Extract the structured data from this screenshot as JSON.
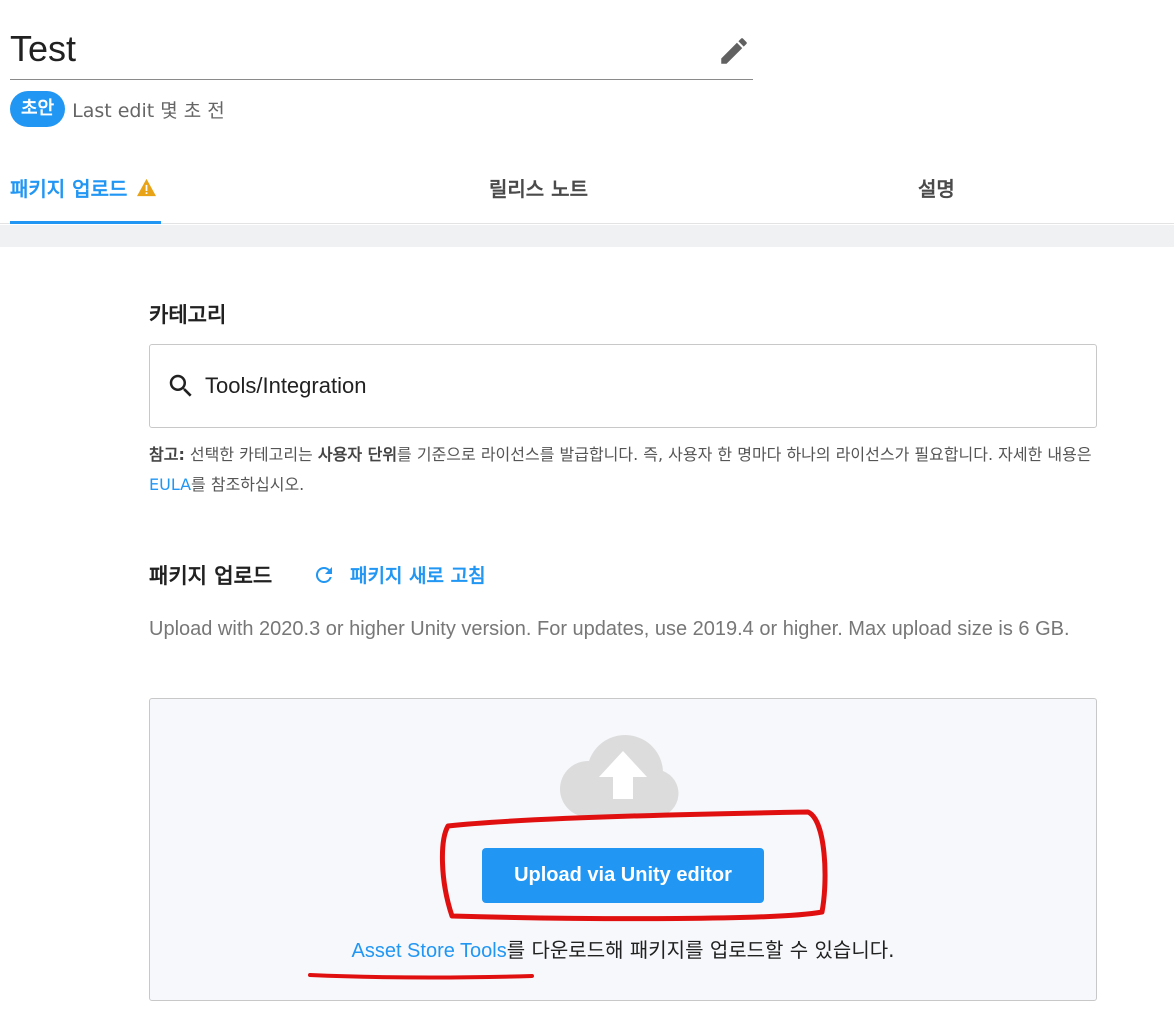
{
  "page": {
    "title": "Test",
    "status_badge": "초안",
    "last_edit": "Last edit 몇 초 전"
  },
  "tabs": [
    {
      "label": "패키지 업로드",
      "active": true,
      "icon": "warning-icon"
    },
    {
      "label": "릴리스 노트",
      "active": false
    },
    {
      "label": "설명",
      "active": false
    }
  ],
  "category": {
    "title": "카테고리",
    "value": "Tools/Integration",
    "icon": "search-icon",
    "note_prefix": "참고:",
    "note_part1": " 선택한 카테고리는 ",
    "note_bold": "사용자 단위",
    "note_part2": "를 기준으로 라이선스를 발급합니다. 즉, 사용자 한 명마다 하나의 라이선스가 필요합니다. 자세한 내용은 ",
    "note_link": "EULA",
    "note_part3": "를 참조하십시오."
  },
  "upload": {
    "title": "패키지 업로드",
    "refresh_label": "패키지 새로 고침",
    "description": "Upload with 2020.3 or higher Unity version. For updates, use 2019.4 or higher. Max upload size is 6 GB.",
    "button_label": "Upload via Unity editor",
    "tools_link": "Asset Store Tools",
    "tools_text": "를 다운로드해 패키지를 업로드할 수 있습니다."
  },
  "colors": {
    "accent": "#2196f3",
    "warning": "#e8a317",
    "annotation": "#e01010"
  }
}
